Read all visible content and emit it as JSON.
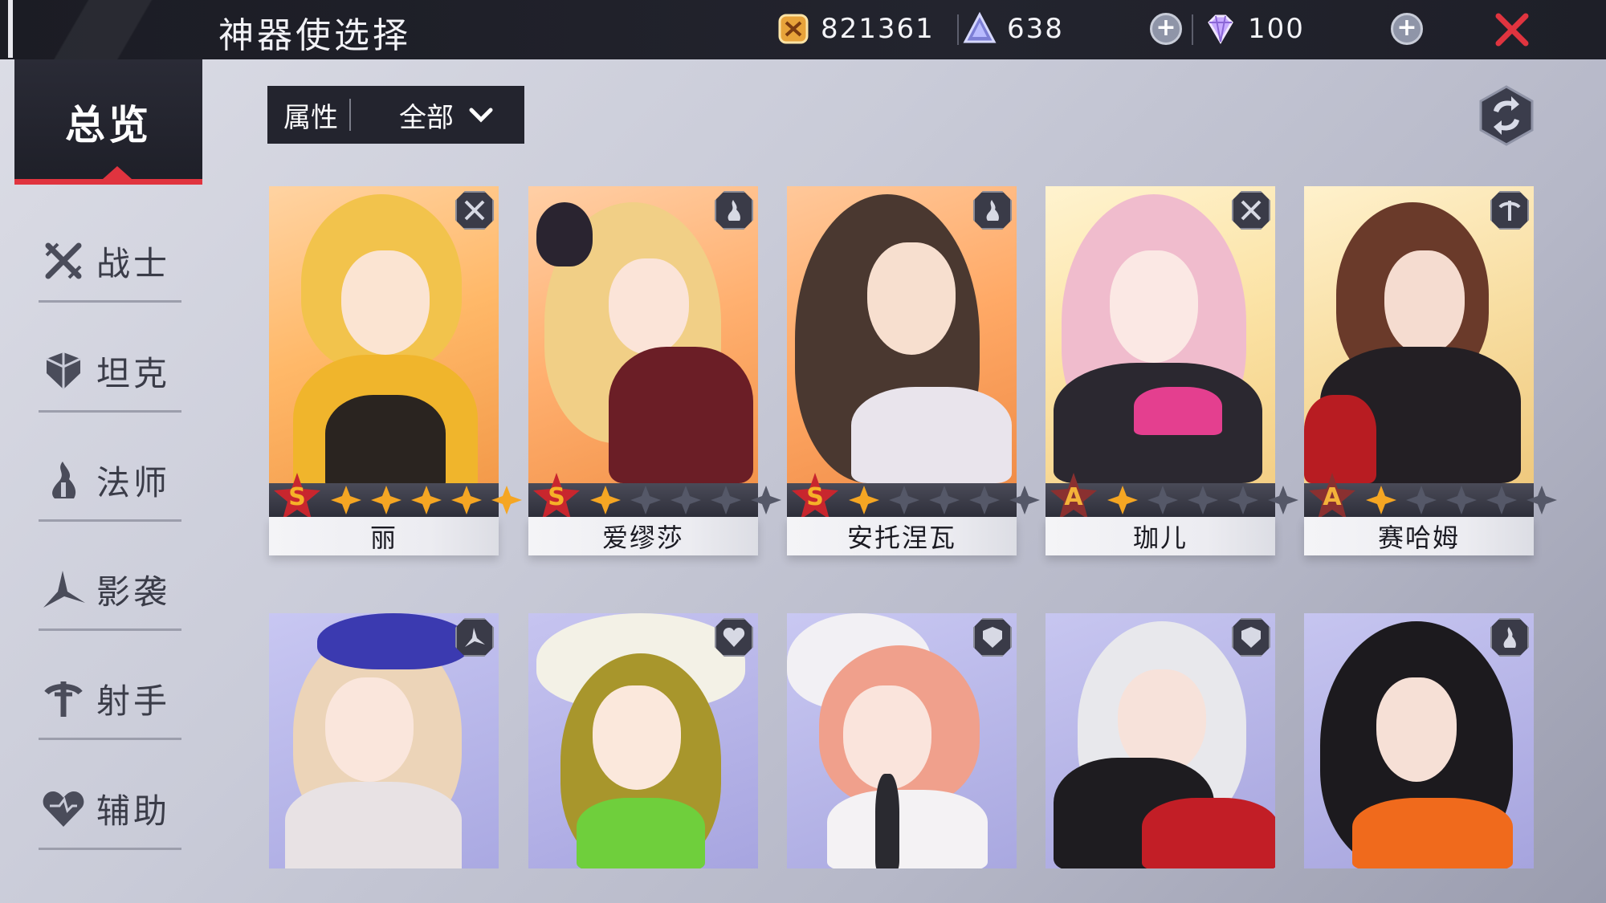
{
  "header": {
    "title": "神器使选择",
    "resources": [
      {
        "icon": "gold-coin-icon",
        "value": "821361"
      },
      {
        "icon": "crystal-icon",
        "value": "638"
      },
      {
        "icon": "diamond-icon",
        "value": "100"
      }
    ]
  },
  "sidebar": {
    "overview": "总览",
    "items": [
      {
        "label": "战士",
        "icon": "warrior-icon"
      },
      {
        "label": "坦克",
        "icon": "tank-icon"
      },
      {
        "label": "法师",
        "icon": "mage-icon"
      },
      {
        "label": "影袭",
        "icon": "assassin-icon"
      },
      {
        "label": "射手",
        "icon": "archer-icon"
      },
      {
        "label": "辅助",
        "icon": "support-icon"
      }
    ]
  },
  "filter": {
    "label": "属性",
    "value": "全部"
  },
  "colors": {
    "accent_red": "#e0343f",
    "star_gold": "#f5a623",
    "rank_s": "#f0a020",
    "rank_a": "#f3b23a"
  },
  "cards": [
    {
      "name": "丽",
      "rank": "S",
      "stars": 5,
      "class_icon": "warrior-icon"
    },
    {
      "name": "爱缪莎",
      "rank": "S",
      "stars": 1,
      "class_icon": "mage-icon"
    },
    {
      "name": "安托涅瓦",
      "rank": "S",
      "stars": 1,
      "class_icon": "mage-icon"
    },
    {
      "name": "珈儿",
      "rank": "A",
      "stars": 1,
      "class_icon": "warrior-icon"
    },
    {
      "name": "赛哈姆",
      "rank": "A",
      "stars": 1,
      "class_icon": "archer-icon"
    },
    {
      "class_icon": "assassin-icon"
    },
    {
      "class_icon": "support-icon"
    },
    {
      "class_icon": "tank-icon"
    },
    {
      "class_icon": "tank-icon"
    },
    {
      "class_icon": "mage-icon"
    }
  ]
}
